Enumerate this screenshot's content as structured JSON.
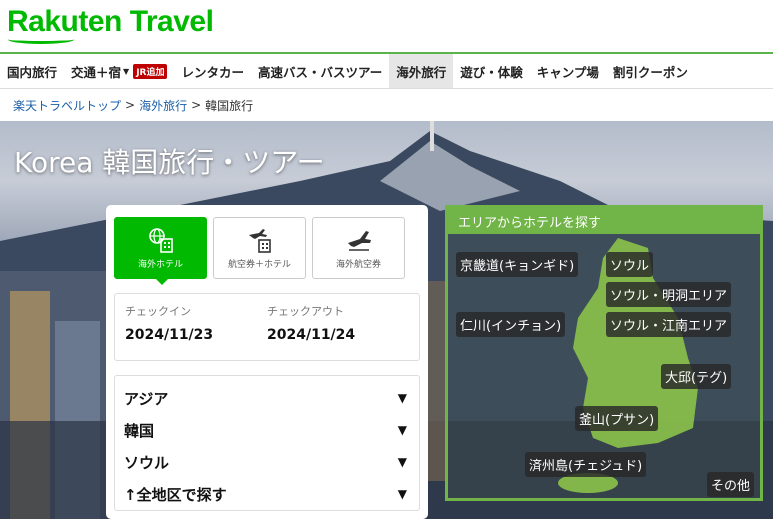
{
  "header": {
    "logo": "Rakuten Travel"
  },
  "nav": {
    "items": [
      "国内旅行",
      "交通＋宿",
      "レンタカー",
      "高速バス・バスツアー",
      "海外旅行",
      "遊び・体験",
      "キャンプ場",
      "割引クーポン"
    ],
    "jr_badge": "JR追加",
    "active": "海外旅行"
  },
  "breadcrumb": {
    "home": "楽天トラベルトップ",
    "overseas": "海外旅行",
    "current": "韓国旅行"
  },
  "hero": {
    "title": "Korea 韓国旅行・ツアー"
  },
  "search": {
    "tabs": [
      "海外ホテル",
      "航空券＋ホテル",
      "海外航空券"
    ],
    "checkin_label": "チェックイン",
    "checkin_value": "2024/11/23",
    "checkout_label": "チェックアウト",
    "checkout_value": "2024/11/24",
    "selects": [
      "アジア",
      "韓国",
      "ソウル",
      "↑全地区で探す"
    ]
  },
  "area": {
    "heading": "エリアからホテルを探す",
    "pills": [
      "京畿道(キョンギド)",
      "ソウル",
      "ソウル・明洞エリア",
      "仁川(インチョン)",
      "ソウル・江南エリア",
      "大邱(テグ)",
      "釜山(プサン)",
      "済州島(チェジュド)",
      "その他"
    ]
  },
  "colors": {
    "brand": "#00b900",
    "accent_red": "#bf0000",
    "area_green": "#71b548",
    "link": "#1a5fa8"
  }
}
